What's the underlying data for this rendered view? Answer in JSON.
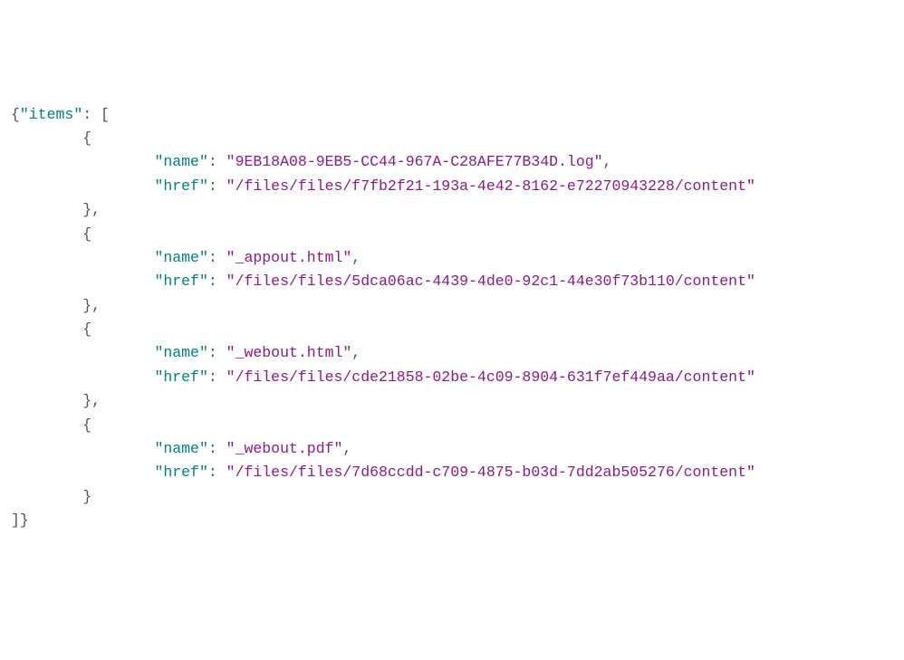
{
  "json": {
    "open_brace": "{",
    "items_key": "\"items\"",
    "colon_space": ": ",
    "open_bracket": "[",
    "close_bracket": "]",
    "close_brace": "}",
    "obj_open": "{",
    "obj_close": "}",
    "obj_close_comma": "},",
    "name_key": "\"name\"",
    "href_key": "\"href\"",
    "comma": ",",
    "items": [
      {
        "name": "\"9EB18A08-9EB5-CC44-967A-C28AFE77B34D.log\"",
        "href": "\"/files/files/f7fb2f21-193a-4e42-8162-e72270943228/content\""
      },
      {
        "name": "\"_appout.html\"",
        "href": "\"/files/files/5dca06ac-4439-4de0-92c1-44e30f73b110/content\""
      },
      {
        "name": "\"_webout.html\"",
        "href": "\"/files/files/cde21858-02be-4c09-8904-631f7ef449aa/content\""
      },
      {
        "name": "\"_webout.pdf\"",
        "href": "\"/files/files/7d68ccdd-c709-4875-b03d-7dd2ab505276/content\""
      }
    ]
  }
}
